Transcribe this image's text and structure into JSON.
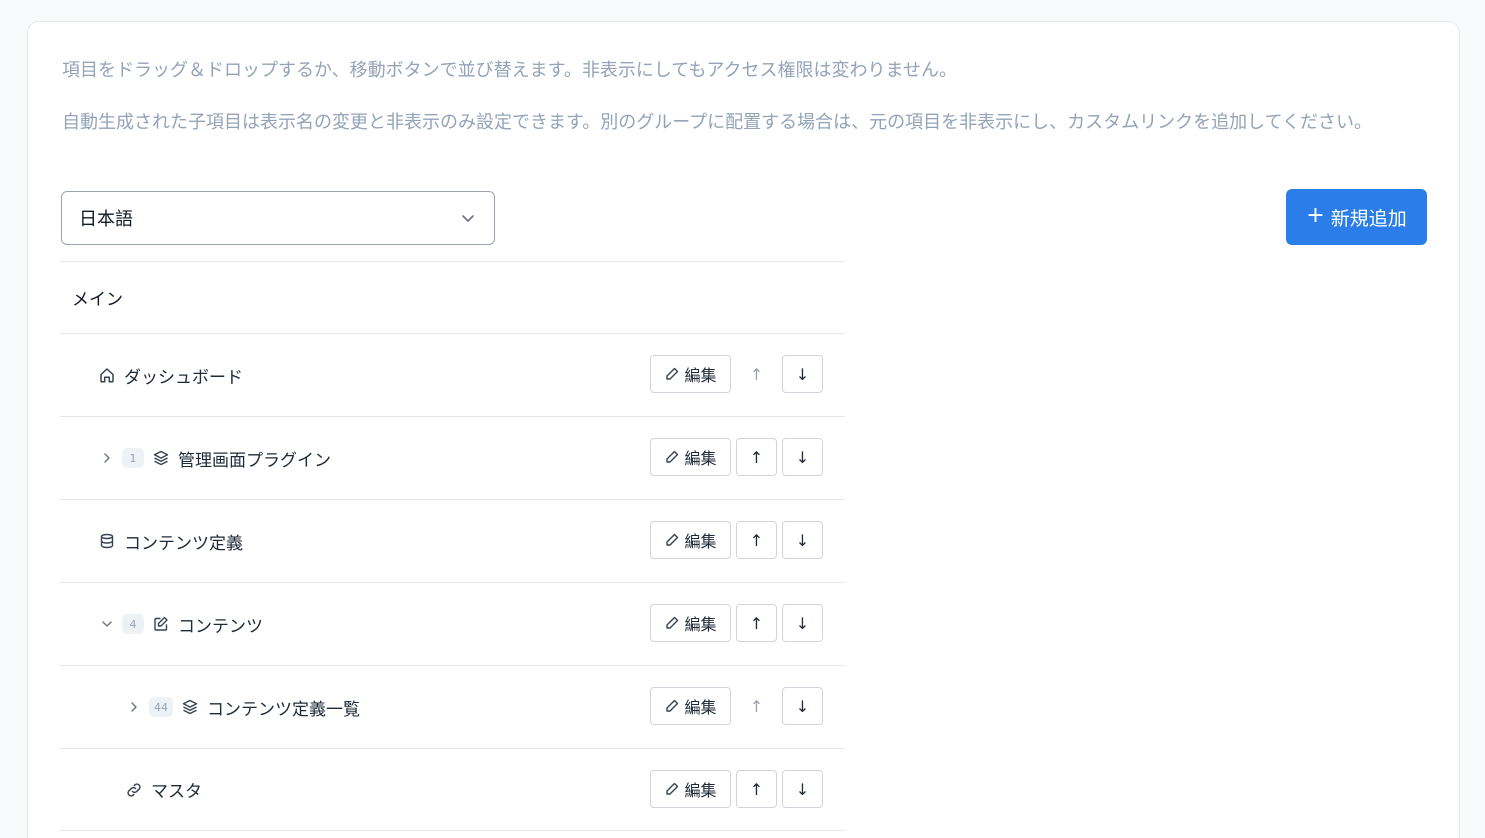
{
  "help": {
    "line1": "項目をドラッグ＆ドロップするか、移動ボタンで並び替えます。非表示にしてもアクセス権限は変わりません。",
    "line2": "自動生成された子項目は表示名の変更と非表示のみ設定できます。別のグループに配置する場合は、元の項目を非表示にし、カスタムリンクを追加してください。"
  },
  "language_select": {
    "value": "日本語"
  },
  "add_button": {
    "label": "新規追加",
    "color": "#2b7de9"
  },
  "group": {
    "label": "メイン"
  },
  "actions": {
    "edit_label": "編集"
  },
  "items": [
    {
      "label": "ダッシュボード",
      "icon": "home-icon",
      "up_disabled": true
    },
    {
      "label": "管理画面プラグイン",
      "icon": "layers-icon",
      "count": "1",
      "expand": "collapsed"
    },
    {
      "label": "コンテンツ定義",
      "icon": "database-icon"
    },
    {
      "label": "コンテンツ",
      "icon": "edit-square-icon",
      "count": "4",
      "expand": "expanded"
    },
    {
      "label": "コンテンツ定義一覧",
      "icon": "layers-icon",
      "count": "44",
      "expand": "collapsed",
      "up_disabled": true
    },
    {
      "label": "マスタ",
      "icon": "link-icon"
    }
  ]
}
